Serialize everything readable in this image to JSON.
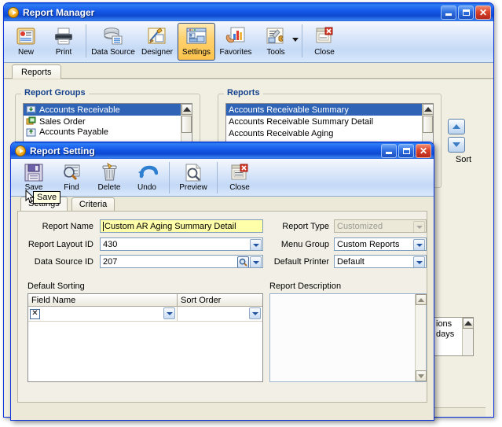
{
  "main_window": {
    "title": "Report Manager",
    "title_icon": "play-circle-icon",
    "window_buttons": {
      "minimize": "minimize-icon",
      "maximize": "maximize-icon",
      "close": "close-icon"
    },
    "toolbar": [
      {
        "label": "New",
        "icon": "new-report-icon",
        "selected": false
      },
      {
        "label": "Print",
        "icon": "printer-icon",
        "selected": false
      },
      {
        "label": "Data Source",
        "icon": "database-icon",
        "selected": false
      },
      {
        "label": "Designer",
        "icon": "designer-icon",
        "selected": false
      },
      {
        "label": "Settings",
        "icon": "settings-window-icon",
        "selected": true
      },
      {
        "label": "Favorites",
        "icon": "favorites-hand-icon",
        "selected": false
      },
      {
        "label": "Tools",
        "icon": "tools-icon",
        "selected": false,
        "has_dropdown": true
      },
      {
        "label": "Close",
        "icon": "close-document-icon",
        "selected": false
      }
    ],
    "tabs": [
      {
        "label": "Reports",
        "active": true
      }
    ],
    "report_groups": {
      "legend": "Report Groups",
      "items": [
        {
          "label": "Accounts Receivable",
          "icon": "ar-group-icon",
          "selected": true
        },
        {
          "label": "Sales Order",
          "icon": "so-group-icon",
          "selected": false
        },
        {
          "label": "Accounts Payable",
          "icon": "ap-group-icon",
          "selected": false
        }
      ]
    },
    "reports": {
      "legend": "Reports",
      "items": [
        {
          "label": "Accounts Receivable Summary",
          "selected": true
        },
        {
          "label": "Accounts Receivable Summary Detail",
          "selected": false
        },
        {
          "label": "Accounts Receivable Aging",
          "selected": false
        }
      ]
    },
    "sort": {
      "label": "Sort",
      "up": "sort-up-icon",
      "down": "sort-down-icon"
    },
    "background_fragments": [
      "ions",
      "days"
    ]
  },
  "dialog": {
    "title": "Report Setting",
    "title_icon": "play-circle-icon",
    "window_buttons": {
      "minimize": "minimize-icon",
      "maximize": "maximize-icon",
      "close": "close-icon"
    },
    "toolbar": [
      {
        "label": "Save",
        "icon": "floppy-save-icon"
      },
      {
        "label": "Find",
        "icon": "find-magnifier-icon"
      },
      {
        "label": "Delete",
        "icon": "trash-delete-icon"
      },
      {
        "label": "Undo",
        "icon": "undo-arrow-icon"
      },
      {
        "label": "Preview",
        "icon": "preview-page-icon"
      },
      {
        "label": "Close",
        "icon": "close-document-icon"
      }
    ],
    "tooltip": "Save",
    "tabs": [
      {
        "label": "Settings",
        "active": true
      },
      {
        "label": "Criteria",
        "active": false
      }
    ],
    "form": {
      "report_name": {
        "label": "Report Name",
        "value": "Custom AR Aging Summary Detail"
      },
      "report_layout_id": {
        "label": "Report Layout ID",
        "value": "430"
      },
      "data_source_id": {
        "label": "Data Source ID",
        "value": "207"
      },
      "report_type": {
        "label": "Report Type",
        "value": "Customized",
        "disabled": true
      },
      "menu_group": {
        "label": "Menu Group",
        "value": "Custom Reports"
      },
      "default_printer": {
        "label": "Default Printer",
        "value": "Default"
      }
    },
    "default_sorting": {
      "label": "Default Sorting",
      "columns": [
        "Field Name",
        "Sort Order"
      ],
      "rows": [
        {
          "field_name": "",
          "sort_order": "",
          "row_marker": "✕"
        }
      ]
    },
    "report_description": {
      "label": "Report Description",
      "value": ""
    }
  }
}
